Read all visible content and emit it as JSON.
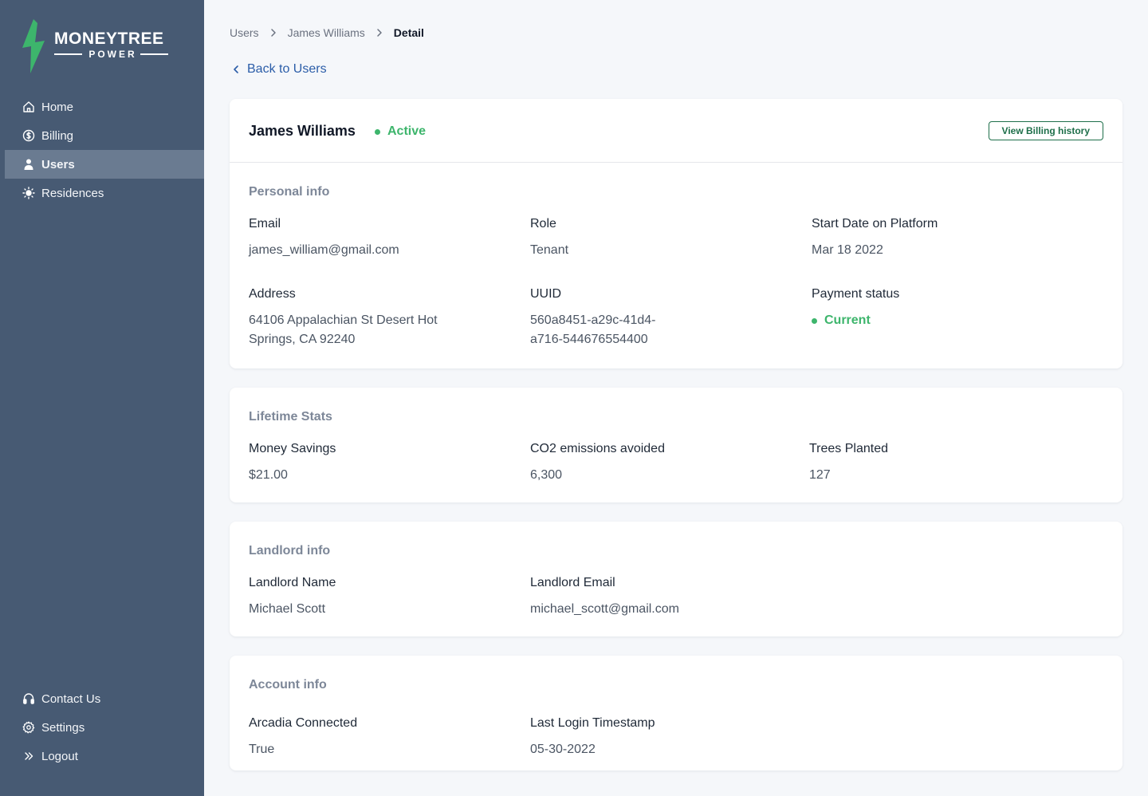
{
  "brand": {
    "name": "MONEYTREE",
    "sub": "POWER",
    "accent_color": "#3db56c"
  },
  "sidebar": {
    "items": [
      {
        "label": "Home",
        "icon": "home-icon"
      },
      {
        "label": "Billing",
        "icon": "dollar-circle-icon"
      },
      {
        "label": "Users",
        "icon": "user-icon",
        "active": true
      },
      {
        "label": "Residences",
        "icon": "sun-icon"
      }
    ],
    "bottom_items": [
      {
        "label": "Contact Us",
        "icon": "headset-icon"
      },
      {
        "label": "Settings",
        "icon": "gear-icon"
      },
      {
        "label": "Logout",
        "icon": "double-chevron-right-icon"
      }
    ]
  },
  "breadcrumb": [
    "Users",
    "James Williams",
    "Detail"
  ],
  "back_link": "Back to Users",
  "user": {
    "name": "James Williams",
    "status": "Active",
    "billing_button": "View Billing history"
  },
  "personal_info": {
    "title": "Personal info",
    "email_label": "Email",
    "email": "james_william@gmail.com",
    "role_label": "Role",
    "role": "Tenant",
    "start_label": "Start Date on Platform",
    "start": "Mar 18 2022",
    "address_label": "Address",
    "address_line1": "64106 Appalachian St Desert Hot",
    "address_line2": "Springs, CA 92240",
    "uuid_label": "UUID",
    "uuid_line1": "560a8451-a29c-41d4-",
    "uuid_line2": "a716-544676554400",
    "payment_label": "Payment status",
    "payment": "Current"
  },
  "lifetime_stats": {
    "title": "Lifetime Stats",
    "savings_label": "Money Savings",
    "savings": "$21.00",
    "co2_label": "CO2 emissions avoided",
    "co2": "6,300",
    "trees_label": "Trees Planted",
    "trees": "127"
  },
  "landlord_info": {
    "title": "Landlord info",
    "name_label": "Landlord Name",
    "name": "Michael Scott",
    "email_label": "Landlord Email",
    "email": "michael_scott@gmail.com"
  },
  "account_info": {
    "title": "Account info",
    "arcadia_label": "Arcadia Connected",
    "arcadia": "True",
    "login_label": "Last Login Timestamp",
    "login": "05-30-2022"
  }
}
